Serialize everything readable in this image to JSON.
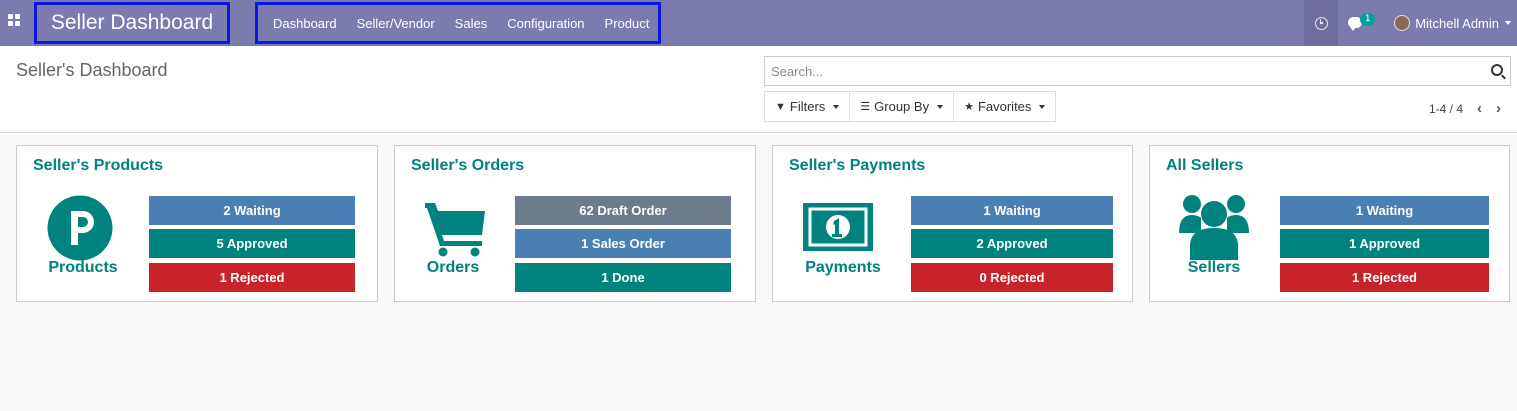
{
  "navbar": {
    "brand": "Seller Dashboard",
    "menu": [
      "Dashboard",
      "Seller/Vendor",
      "Sales",
      "Configuration",
      "Product"
    ],
    "chat_badge": "1",
    "user_name": "Mitchell Admin",
    "color": "#7c7bad"
  },
  "control": {
    "title": "Seller's Dashboard",
    "search_placeholder": "Search...",
    "filters_label": "Filters",
    "groupby_label": "Group By",
    "favorites_label": "Favorites",
    "pager": "1-4 / 4",
    "prev": "‹",
    "next": "›"
  },
  "colors": {
    "teal": "#00827f",
    "blue": "#4a7fb3",
    "red": "#c8232a",
    "gray": "#6d7b8a"
  },
  "cards": [
    {
      "title": "Seller's Products",
      "label": "Products",
      "icon": "parking-circle-icon",
      "stats": [
        "2 Waiting",
        "5 Approved",
        "1 Rejected"
      ]
    },
    {
      "title": "Seller's Orders",
      "label": "Orders",
      "icon": "shopping-cart-icon",
      "stats": [
        "62 Draft Order",
        "1 Sales Order",
        "1 Done"
      ]
    },
    {
      "title": "Seller's Payments",
      "label": "Payments",
      "icon": "money-bill-icon",
      "stats": [
        "1 Waiting",
        "2 Approved",
        "0 Rejected"
      ]
    },
    {
      "title": "All Sellers",
      "label": "Sellers",
      "icon": "users-icon",
      "stats": [
        "1 Waiting",
        "1 Approved",
        "1 Rejected"
      ]
    }
  ]
}
